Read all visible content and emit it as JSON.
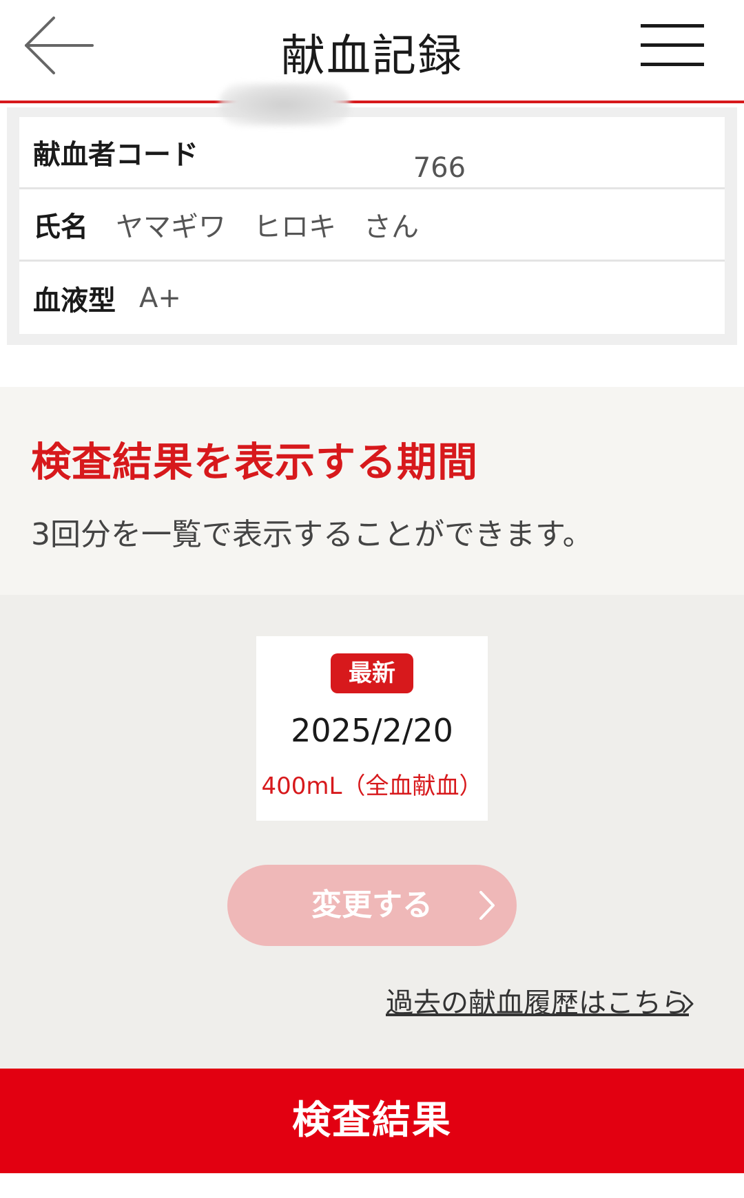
{
  "header": {
    "title": "献血記録",
    "back_icon": "arrow-left-icon",
    "menu_icon": "hamburger-menu-icon"
  },
  "donor": {
    "code_label": "献血者コード",
    "code_value_visible": "766",
    "name_label": "氏名",
    "name_value": "ヤマギワ　ヒロキ　さん",
    "blood_type_label": "血液型",
    "blood_type_value": "A+"
  },
  "period": {
    "title": "検査結果を表示する期間",
    "description": "3回分を一覧で表示することができます。"
  },
  "selected_result": {
    "badge": "最新",
    "date": "2025/2/20",
    "volume": "400mL（全血献血）"
  },
  "actions": {
    "change_label": "変更する",
    "history_link": "過去の献血履歴はこちら",
    "result_button": "検査結果"
  },
  "colors": {
    "accent_red": "#d7191c",
    "button_red": "#e20011",
    "disabled_pink": "#efb8b8"
  }
}
